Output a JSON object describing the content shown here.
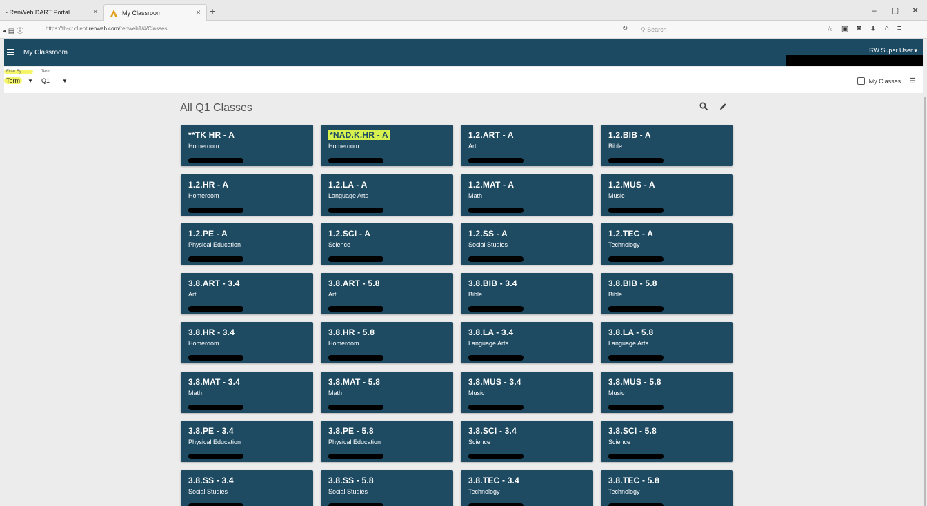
{
  "browser": {
    "tabs": [
      {
        "title": "- RenWeb DART Portal"
      },
      {
        "title": "My Classroom"
      }
    ],
    "new_tab": "+",
    "url_prefix": "https://tb-cr.client.",
    "url_domain": "renweb.com",
    "url_suffix": "/renweb1/#/Classes",
    "search_placeholder": "Search",
    "window_controls": [
      "–",
      "▢",
      "✕"
    ]
  },
  "app": {
    "title": "My Classroom",
    "user": "RW Super User"
  },
  "filters": {
    "filter_by_label": "Filter By",
    "filter_by_value": "Term",
    "term_label": "Term",
    "term_value": "Q1",
    "my_classes_label": "My Classes"
  },
  "main": {
    "title": "All Q1 Classes"
  },
  "classes": [
    {
      "name": "**TK HR - A",
      "subject": "Homeroom"
    },
    {
      "name": "*NAD.K.HR - A",
      "subject": "Homeroom"
    },
    {
      "name": "1.2.ART - A",
      "subject": "Art"
    },
    {
      "name": "1.2.BIB - A",
      "subject": "Bible"
    },
    {
      "name": "1.2.HR - A",
      "subject": "Homeroom"
    },
    {
      "name": "1.2.LA - A",
      "subject": "Language Arts"
    },
    {
      "name": "1.2.MAT - A",
      "subject": "Math"
    },
    {
      "name": "1.2.MUS - A",
      "subject": "Music"
    },
    {
      "name": "1.2.PE - A",
      "subject": "Physical Education"
    },
    {
      "name": "1.2.SCI - A",
      "subject": "Science"
    },
    {
      "name": "1.2.SS - A",
      "subject": "Social Studies"
    },
    {
      "name": "1.2.TEC - A",
      "subject": "Technology"
    },
    {
      "name": "3.8.ART - 3.4",
      "subject": "Art"
    },
    {
      "name": "3.8.ART - 5.8",
      "subject": "Art"
    },
    {
      "name": "3.8.BIB - 3.4",
      "subject": "Bible"
    },
    {
      "name": "3.8.BIB - 5.8",
      "subject": "Bible"
    },
    {
      "name": "3.8.HR - 3.4",
      "subject": "Homeroom"
    },
    {
      "name": "3.8.HR - 5.8",
      "subject": "Homeroom"
    },
    {
      "name": "3.8.LA - 3.4",
      "subject": "Language Arts"
    },
    {
      "name": "3.8.LA - 5.8",
      "subject": "Language Arts"
    },
    {
      "name": "3.8.MAT - 3.4",
      "subject": "Math"
    },
    {
      "name": "3.8.MAT - 5.8",
      "subject": "Math"
    },
    {
      "name": "3.8.MUS - 3.4",
      "subject": "Music"
    },
    {
      "name": "3.8.MUS - 5.8",
      "subject": "Music"
    },
    {
      "name": "3.8.PE - 3.4",
      "subject": "Physical Education"
    },
    {
      "name": "3.8.PE - 5.8",
      "subject": "Physical Education"
    },
    {
      "name": "3.8.SCI - 3.4",
      "subject": "Science"
    },
    {
      "name": "3.8.SCI - 5.8",
      "subject": "Science"
    },
    {
      "name": "3.8.SS - 3.4",
      "subject": "Social Studies"
    },
    {
      "name": "3.8.SS - 5.8",
      "subject": "Social Studies"
    },
    {
      "name": "3.8.TEC - 3.4",
      "subject": "Technology"
    },
    {
      "name": "3.8.TEC - 5.8",
      "subject": "Technology"
    }
  ],
  "colors": {
    "header": "#1c4a63",
    "card": "#1e4a62",
    "highlight": "#f5f56a"
  }
}
